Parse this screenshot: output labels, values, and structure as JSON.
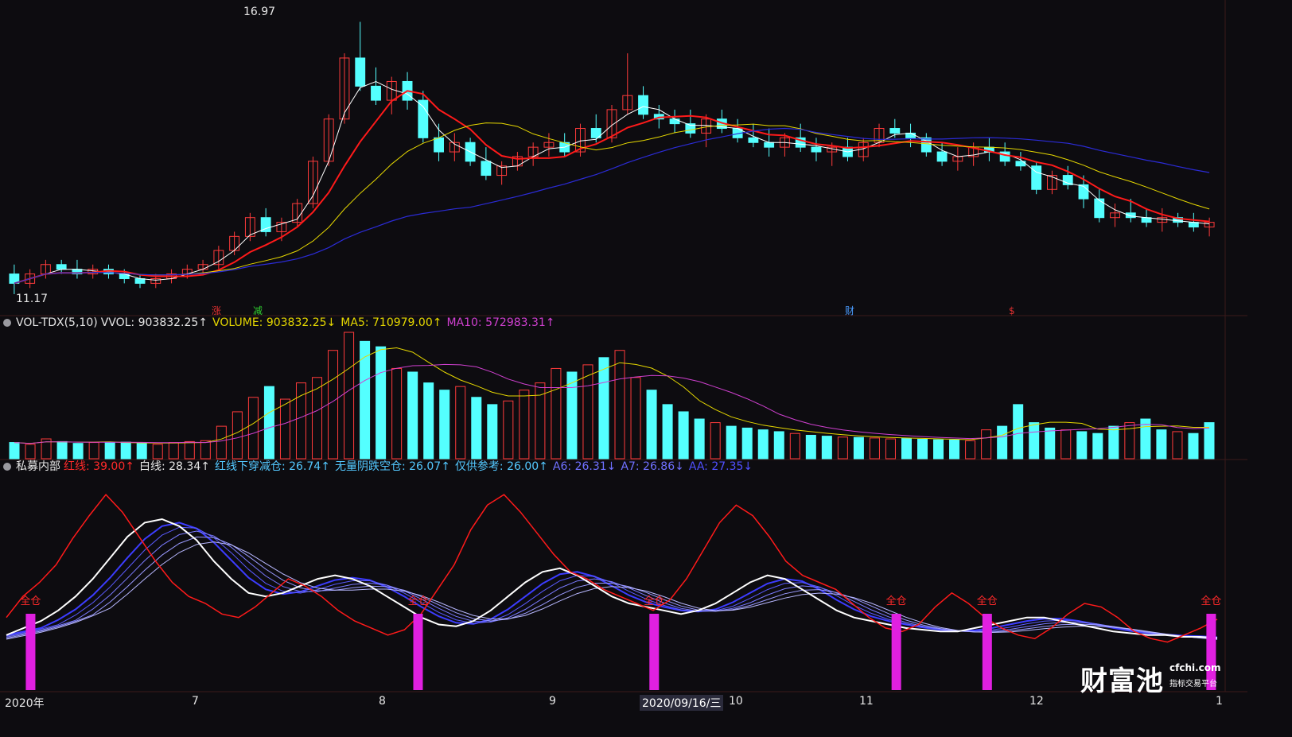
{
  "price_panel": {
    "high_label": "16.97",
    "low_label": "11.17",
    "markers": [
      {
        "text": "涨",
        "color": "#e03030"
      },
      {
        "text": "减",
        "color": "#30d030"
      },
      {
        "text": "财",
        "color": "#4a9cff"
      },
      {
        "text": "$",
        "color": "#e03030"
      }
    ]
  },
  "vol_panel": {
    "name": "VOL-TDX(5,10)",
    "vvol": "VVOL: 903832.25↑",
    "volume": "VOLUME: 903832.25↓",
    "ma5": "MA5: 710979.00↑",
    "ma10": "MA10: 572983.31↑"
  },
  "ind_panel": {
    "name": "私募内部",
    "red": "红线: 39.00↑",
    "white": "白线: 28.34↑",
    "cross": "红线下穿减仓: 26.74↑",
    "noyin": "无量阴跌空仓: 26.07↑",
    "ref": "仅供参考: 26.00↑",
    "a6": "A6: 26.31↓",
    "a7": "A7: 26.86↓",
    "aa": "AA: 27.35↓",
    "signal_label": "全仓"
  },
  "x_axis": {
    "labels": [
      "2020年",
      "7",
      "8",
      "9",
      "2020/09/16/三",
      "10",
      "11",
      "12",
      "1"
    ]
  },
  "logo": {
    "name": "财富池",
    "domain": "cfchi.com",
    "tagline": "指标交易平台"
  },
  "colors": {
    "up": "#ff3b3b",
    "down": "#54ffff",
    "ma_white": "#ffffff",
    "ma_red": "#ff1a1a",
    "ma_yellow": "#e6d800",
    "ma_blue": "#2b2bd6",
    "vol_ma5": "#e6d800",
    "vol_ma10": "#d040d0",
    "signal_bar": "#e020e0"
  },
  "chart_data": [
    {
      "type": "candlestick",
      "title": "",
      "series_note": "daily OHLC, 2020",
      "ylim": [
        11.0,
        17.3
      ],
      "ohlc": [
        [
          11.6,
          11.8,
          11.17,
          11.4
        ],
        [
          11.4,
          11.7,
          11.3,
          11.6
        ],
        [
          11.6,
          11.9,
          11.5,
          11.8
        ],
        [
          11.8,
          11.9,
          11.6,
          11.7
        ],
        [
          11.7,
          11.9,
          11.5,
          11.6
        ],
        [
          11.6,
          11.8,
          11.5,
          11.7
        ],
        [
          11.7,
          11.8,
          11.5,
          11.6
        ],
        [
          11.6,
          11.7,
          11.4,
          11.5
        ],
        [
          11.5,
          11.6,
          11.3,
          11.4
        ],
        [
          11.4,
          11.6,
          11.3,
          11.5
        ],
        [
          11.5,
          11.7,
          11.4,
          11.6
        ],
        [
          11.6,
          11.8,
          11.5,
          11.7
        ],
        [
          11.7,
          11.9,
          11.6,
          11.8
        ],
        [
          11.8,
          12.2,
          11.7,
          12.1
        ],
        [
          12.1,
          12.5,
          12.0,
          12.4
        ],
        [
          12.4,
          12.9,
          12.3,
          12.8
        ],
        [
          12.8,
          13.0,
          12.4,
          12.5
        ],
        [
          12.5,
          12.8,
          12.3,
          12.7
        ],
        [
          12.7,
          13.2,
          12.6,
          13.1
        ],
        [
          13.1,
          14.1,
          13.0,
          14.0
        ],
        [
          14.0,
          15.0,
          13.9,
          14.9
        ],
        [
          14.9,
          16.3,
          14.8,
          16.2
        ],
        [
          16.2,
          16.97,
          15.5,
          15.6
        ],
        [
          15.6,
          16.0,
          15.2,
          15.3
        ],
        [
          15.3,
          15.8,
          15.0,
          15.7
        ],
        [
          15.7,
          15.9,
          15.1,
          15.3
        ],
        [
          15.3,
          15.5,
          14.4,
          14.5
        ],
        [
          14.5,
          14.8,
          14.0,
          14.2
        ],
        [
          14.2,
          14.6,
          14.0,
          14.4
        ],
        [
          14.4,
          14.5,
          13.9,
          14.0
        ],
        [
          14.0,
          14.3,
          13.6,
          13.7
        ],
        [
          13.7,
          14.0,
          13.5,
          13.9
        ],
        [
          13.9,
          14.2,
          13.8,
          14.1
        ],
        [
          14.1,
          14.4,
          13.9,
          14.3
        ],
        [
          14.3,
          14.6,
          14.1,
          14.4
        ],
        [
          14.4,
          14.6,
          14.1,
          14.2
        ],
        [
          14.2,
          14.8,
          14.1,
          14.7
        ],
        [
          14.7,
          15.0,
          14.4,
          14.5
        ],
        [
          14.5,
          15.2,
          14.4,
          15.1
        ],
        [
          15.1,
          16.3,
          15.0,
          15.4
        ],
        [
          15.4,
          15.6,
          14.9,
          15.0
        ],
        [
          15.0,
          15.2,
          14.7,
          14.9
        ],
        [
          14.9,
          15.1,
          14.6,
          14.8
        ],
        [
          14.8,
          15.1,
          14.5,
          14.6
        ],
        [
          14.6,
          15.0,
          14.3,
          14.9
        ],
        [
          14.9,
          15.1,
          14.6,
          14.7
        ],
        [
          14.7,
          14.9,
          14.4,
          14.5
        ],
        [
          14.5,
          14.8,
          14.3,
          14.4
        ],
        [
          14.4,
          14.7,
          14.1,
          14.3
        ],
        [
          14.3,
          14.6,
          14.1,
          14.5
        ],
        [
          14.5,
          14.8,
          14.2,
          14.3
        ],
        [
          14.3,
          14.5,
          14.0,
          14.2
        ],
        [
          14.2,
          14.4,
          13.9,
          14.3
        ],
        [
          14.3,
          14.5,
          14.0,
          14.1
        ],
        [
          14.1,
          14.5,
          14.0,
          14.4
        ],
        [
          14.4,
          14.8,
          14.3,
          14.7
        ],
        [
          14.7,
          14.9,
          14.5,
          14.6
        ],
        [
          14.6,
          14.8,
          14.3,
          14.5
        ],
        [
          14.5,
          14.6,
          14.1,
          14.2
        ],
        [
          14.2,
          14.4,
          13.9,
          14.0
        ],
        [
          14.0,
          14.3,
          13.8,
          14.1
        ],
        [
          14.1,
          14.4,
          13.9,
          14.3
        ],
        [
          14.3,
          14.5,
          14.0,
          14.2
        ],
        [
          14.2,
          14.4,
          13.9,
          14.0
        ],
        [
          14.0,
          14.2,
          13.8,
          13.9
        ],
        [
          13.9,
          14.0,
          13.3,
          13.4
        ],
        [
          13.4,
          13.8,
          13.3,
          13.7
        ],
        [
          13.7,
          13.9,
          13.4,
          13.5
        ],
        [
          13.5,
          13.7,
          13.0,
          13.2
        ],
        [
          13.2,
          13.4,
          12.7,
          12.8
        ],
        [
          12.8,
          13.1,
          12.6,
          12.9
        ],
        [
          12.9,
          13.2,
          12.7,
          12.8
        ],
        [
          12.8,
          13.0,
          12.6,
          12.7
        ],
        [
          12.7,
          13.0,
          12.5,
          12.8
        ],
        [
          12.8,
          12.9,
          12.6,
          12.7
        ],
        [
          12.7,
          12.9,
          12.5,
          12.6
        ],
        [
          12.6,
          12.8,
          12.4,
          12.7
        ]
      ]
    },
    {
      "type": "bar",
      "title": "VOL-TDX(5,10)",
      "values": [
        90,
        80,
        110,
        95,
        85,
        90,
        88,
        92,
        85,
        80,
        90,
        95,
        100,
        180,
        260,
        340,
        400,
        330,
        420,
        450,
        600,
        700,
        650,
        620,
        500,
        480,
        420,
        380,
        400,
        340,
        300,
        320,
        380,
        420,
        500,
        480,
        520,
        560,
        600,
        450,
        380,
        300,
        260,
        220,
        200,
        180,
        170,
        160,
        150,
        140,
        130,
        125,
        120,
        118,
        115,
        110,
        112,
        108,
        105,
        104,
        100,
        160,
        180,
        300,
        200,
        170,
        160,
        150,
        140,
        180,
        200,
        220,
        160,
        150,
        140,
        200
      ]
    },
    {
      "type": "line",
      "title": "私募内部",
      "series": [
        {
          "name": "红线",
          "values": [
            40,
            52,
            60,
            70,
            85,
            98,
            110,
            100,
            86,
            72,
            60,
            52,
            48,
            42,
            40,
            46,
            54,
            62,
            58,
            52,
            44,
            38,
            34,
            30,
            33,
            42,
            56,
            70,
            90,
            104,
            110,
            100,
            88,
            76,
            66,
            62,
            56,
            52,
            48,
            44,
            50,
            62,
            78,
            94,
            104,
            98,
            86,
            72,
            64,
            60,
            56,
            48,
            40,
            34,
            32,
            36,
            46,
            54,
            48,
            40,
            34,
            30,
            28,
            34,
            42,
            48,
            46,
            40,
            32,
            28,
            26,
            30,
            34,
            39
          ]
        },
        {
          "name": "白线",
          "values": [
            30,
            34,
            38,
            44,
            52,
            62,
            74,
            86,
            94,
            96,
            92,
            84,
            72,
            62,
            54,
            52,
            54,
            58,
            62,
            64,
            62,
            58,
            52,
            46,
            40,
            36,
            35,
            38,
            44,
            52,
            60,
            66,
            68,
            64,
            58,
            52,
            48,
            46,
            44,
            42,
            44,
            48,
            54,
            60,
            64,
            62,
            56,
            50,
            44,
            40,
            38,
            36,
            34,
            33,
            32,
            32,
            34,
            36,
            38,
            40,
            40,
            38,
            36,
            34,
            32,
            31,
            30,
            30,
            29,
            29,
            28.34
          ]
        }
      ],
      "signals_full_position": [
        "2020年起点",
        "8月初",
        "9月下旬",
        "11月中",
        "12月初",
        "1月"
      ]
    }
  ]
}
